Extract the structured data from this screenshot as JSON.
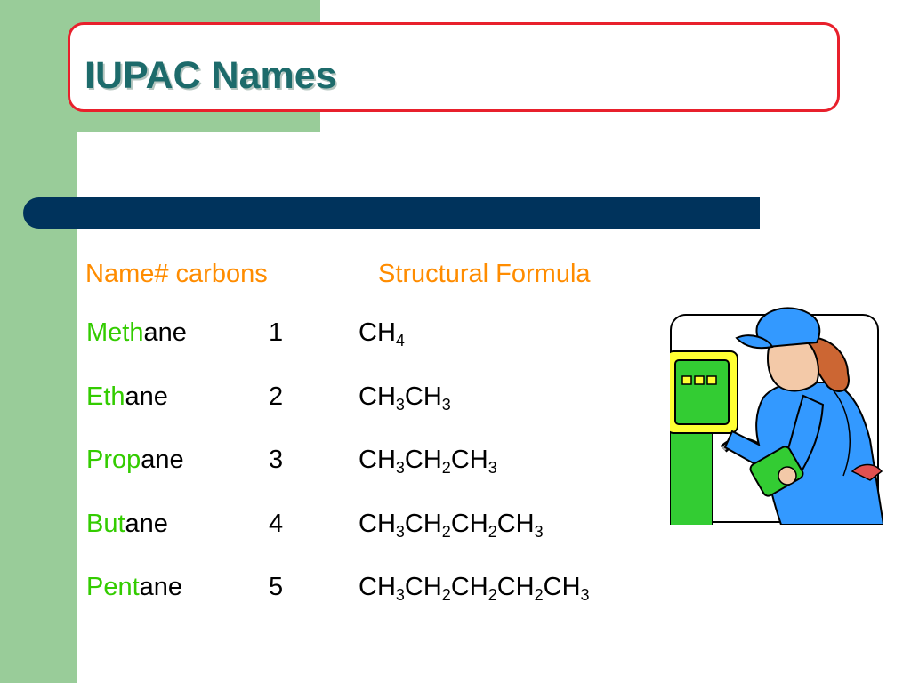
{
  "slide": {
    "title": "IUPAC Names",
    "header": {
      "name_carbons": "Name# carbons",
      "structural_formula": "Structural Formula"
    },
    "rows": [
      {
        "prefix": "Meth",
        "suffix": "ane",
        "carbons": "1",
        "formula": [
          [
            "CH",
            ""
          ],
          [
            "",
            "4"
          ]
        ]
      },
      {
        "prefix": "Eth",
        "suffix": "ane",
        "carbons": "2",
        "formula": [
          [
            "CH",
            "3"
          ],
          [
            "CH",
            "3"
          ]
        ]
      },
      {
        "prefix": "Prop",
        "suffix": "ane",
        "carbons": "3",
        "formula": [
          [
            "CH",
            "3"
          ],
          [
            "CH",
            "2"
          ],
          [
            "CH",
            "3"
          ]
        ]
      },
      {
        "prefix": "But",
        "suffix": "ane",
        "carbons": "4",
        "formula": [
          [
            "CH",
            "3"
          ],
          [
            "CH",
            "2"
          ],
          [
            "CH",
            "2"
          ],
          [
            "CH",
            "3"
          ]
        ]
      },
      {
        "prefix": "Pent",
        "suffix": "ane",
        "carbons": "5",
        "formula": [
          [
            "CH",
            "3"
          ],
          [
            "CH",
            "2"
          ],
          [
            "CH",
            "2"
          ],
          [
            "CH",
            "2"
          ],
          [
            "CH",
            "3"
          ]
        ]
      }
    ],
    "illustration": "gas-pump-attendant-clipart",
    "colors": {
      "accent_green": "#99cc99",
      "title_box_border": "#e8202c",
      "title_text": "#1d6b6b",
      "divider_bar": "#00335c",
      "header_orange": "#ff8c00",
      "prefix_green": "#33cc00"
    }
  }
}
